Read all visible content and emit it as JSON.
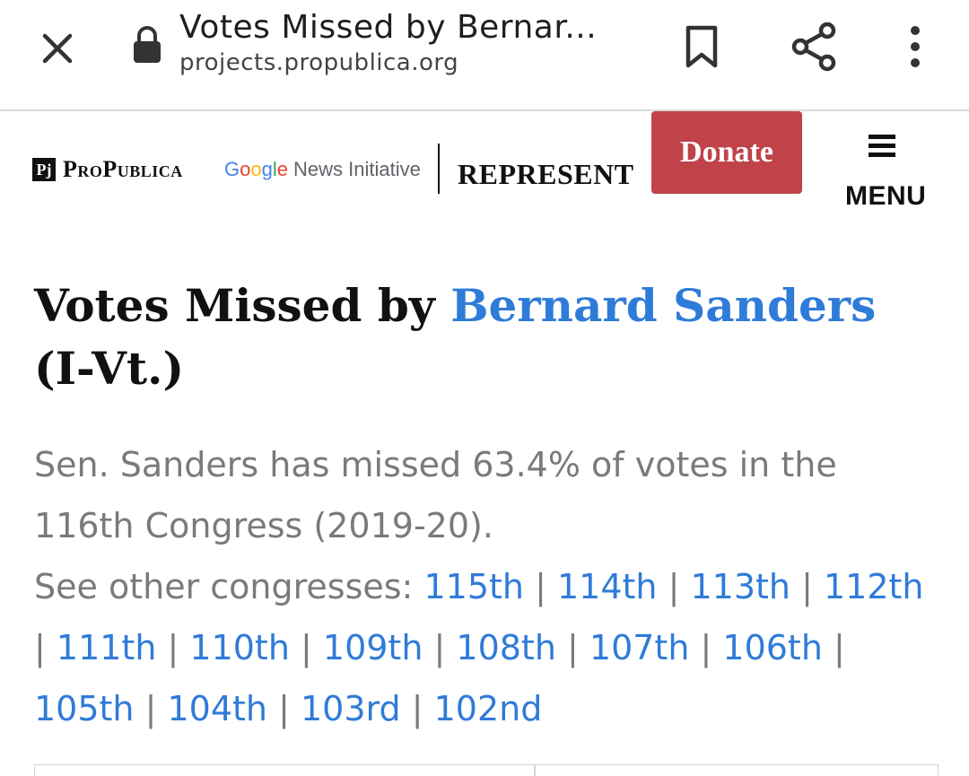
{
  "browser": {
    "title": "Votes Missed by Bernar...",
    "url": "projects.propublica.org"
  },
  "site": {
    "pp_mark": "Pj",
    "pp_name": "ProPublica",
    "gni_google_letters": [
      "G",
      "o",
      "o",
      "g",
      "l",
      "e"
    ],
    "gni_google_colors": [
      "#4285F4",
      "#EA4335",
      "#FBBC05",
      "#4285F4",
      "#34A853",
      "#EA4335"
    ],
    "gni_rest": "News Initiative",
    "represent": "REPRESENT",
    "donate_label": "Donate",
    "menu_label": "MENU",
    "donate_color": "#c0434a",
    "link_color": "#2f7bd8"
  },
  "content": {
    "headline_prefix": "Votes Missed by ",
    "headline_name": "Bernard Sanders",
    "headline_suffix": " (I-Vt.)",
    "summary_text": "Sen. Sanders has missed 63.4% of votes in the 116th Congress (2019-20).",
    "see_other_label": "See other congresses:",
    "congresses": [
      "115th",
      "114th",
      "113th",
      "112th",
      "111th",
      "110th",
      "109th",
      "108th",
      "107th",
      "106th",
      "105th",
      "104th",
      "103rd",
      "102nd"
    ]
  }
}
